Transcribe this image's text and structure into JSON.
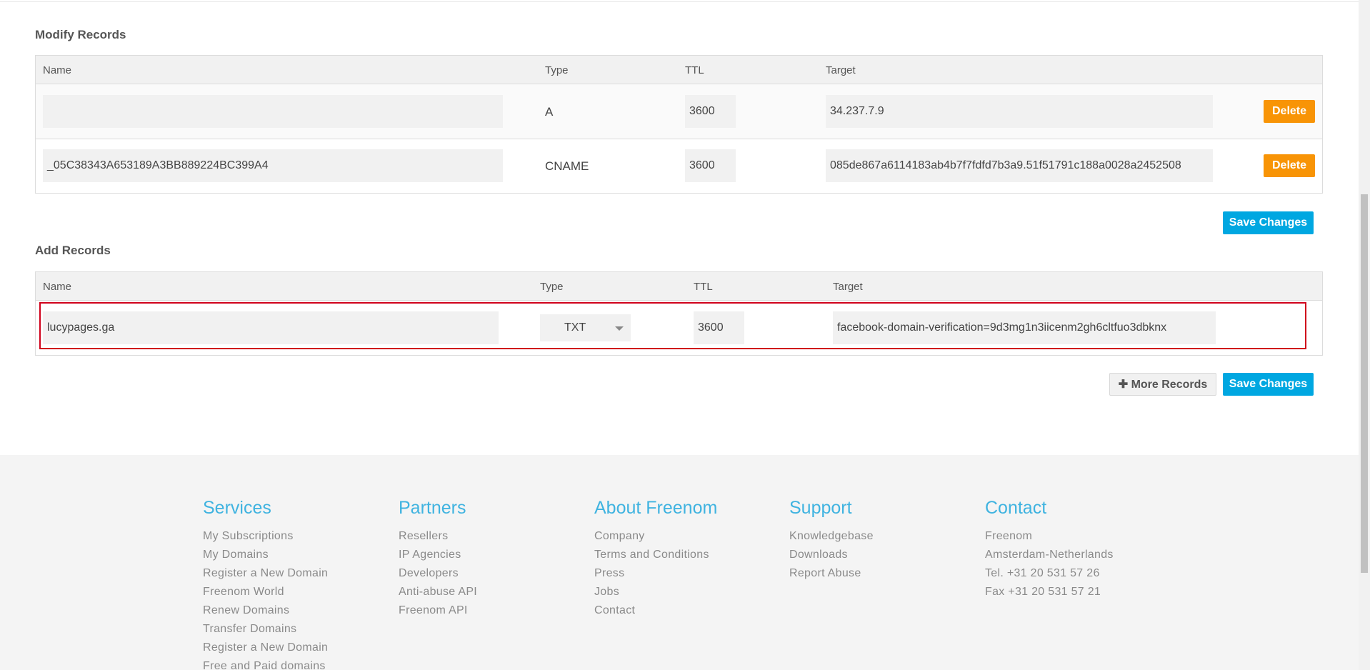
{
  "modify": {
    "title": "Modify Records",
    "headers": {
      "name": "Name",
      "type": "Type",
      "ttl": "TTL",
      "target": "Target"
    },
    "rows": [
      {
        "name": "",
        "type": "A",
        "ttl": "3600",
        "target": "34.237.7.9",
        "delete_label": "Delete"
      },
      {
        "name": "_05C38343A653189A3BB889224BC399A4",
        "type": "CNAME",
        "ttl": "3600",
        "target": "085de867a6114183ab4b7f7fdfd7b3a9.51f51791c188a0028a2452508",
        "delete_label": "Delete"
      }
    ],
    "save_label": "Save Changes"
  },
  "add": {
    "title": "Add Records",
    "headers": {
      "name": "Name",
      "type": "Type",
      "ttl": "TTL",
      "target": "Target"
    },
    "row": {
      "name": "lucypages.ga",
      "type": "TXT",
      "ttl": "3600",
      "target": "facebook-domain-verification=9d3mg1n3iicenm2gh6cltfuo3dbknx"
    },
    "more_label": "More Records",
    "save_label": "Save Changes"
  },
  "footer": {
    "services": {
      "title": "Services",
      "links": [
        "My Subscriptions",
        "My Domains",
        "Register a New Domain",
        "Freenom World",
        "Renew Domains",
        "Transfer Domains",
        "Register a New Domain",
        "Free and Paid domains"
      ]
    },
    "partners": {
      "title": "Partners",
      "links": [
        "Resellers",
        "IP Agencies",
        "Developers",
        "Anti-abuse API",
        "Freenom API"
      ]
    },
    "about": {
      "title": "About Freenom",
      "links": [
        "Company",
        "Terms and Conditions",
        "Press",
        "Jobs",
        "Contact"
      ]
    },
    "support": {
      "title": "Support",
      "links": [
        "Knowledgebase",
        "Downloads",
        "Report Abuse"
      ]
    },
    "contact": {
      "title": "Contact",
      "links": [
        "Freenom",
        "Amsterdam-Netherlands",
        "Tel. +31 20 531 57 26",
        "Fax +31 20 531 57 21"
      ]
    }
  },
  "colors": {
    "delete": "#f89406",
    "save": "#00a7e1",
    "footer_heading": "#3fb3e0",
    "highlight": "#d0021b"
  }
}
